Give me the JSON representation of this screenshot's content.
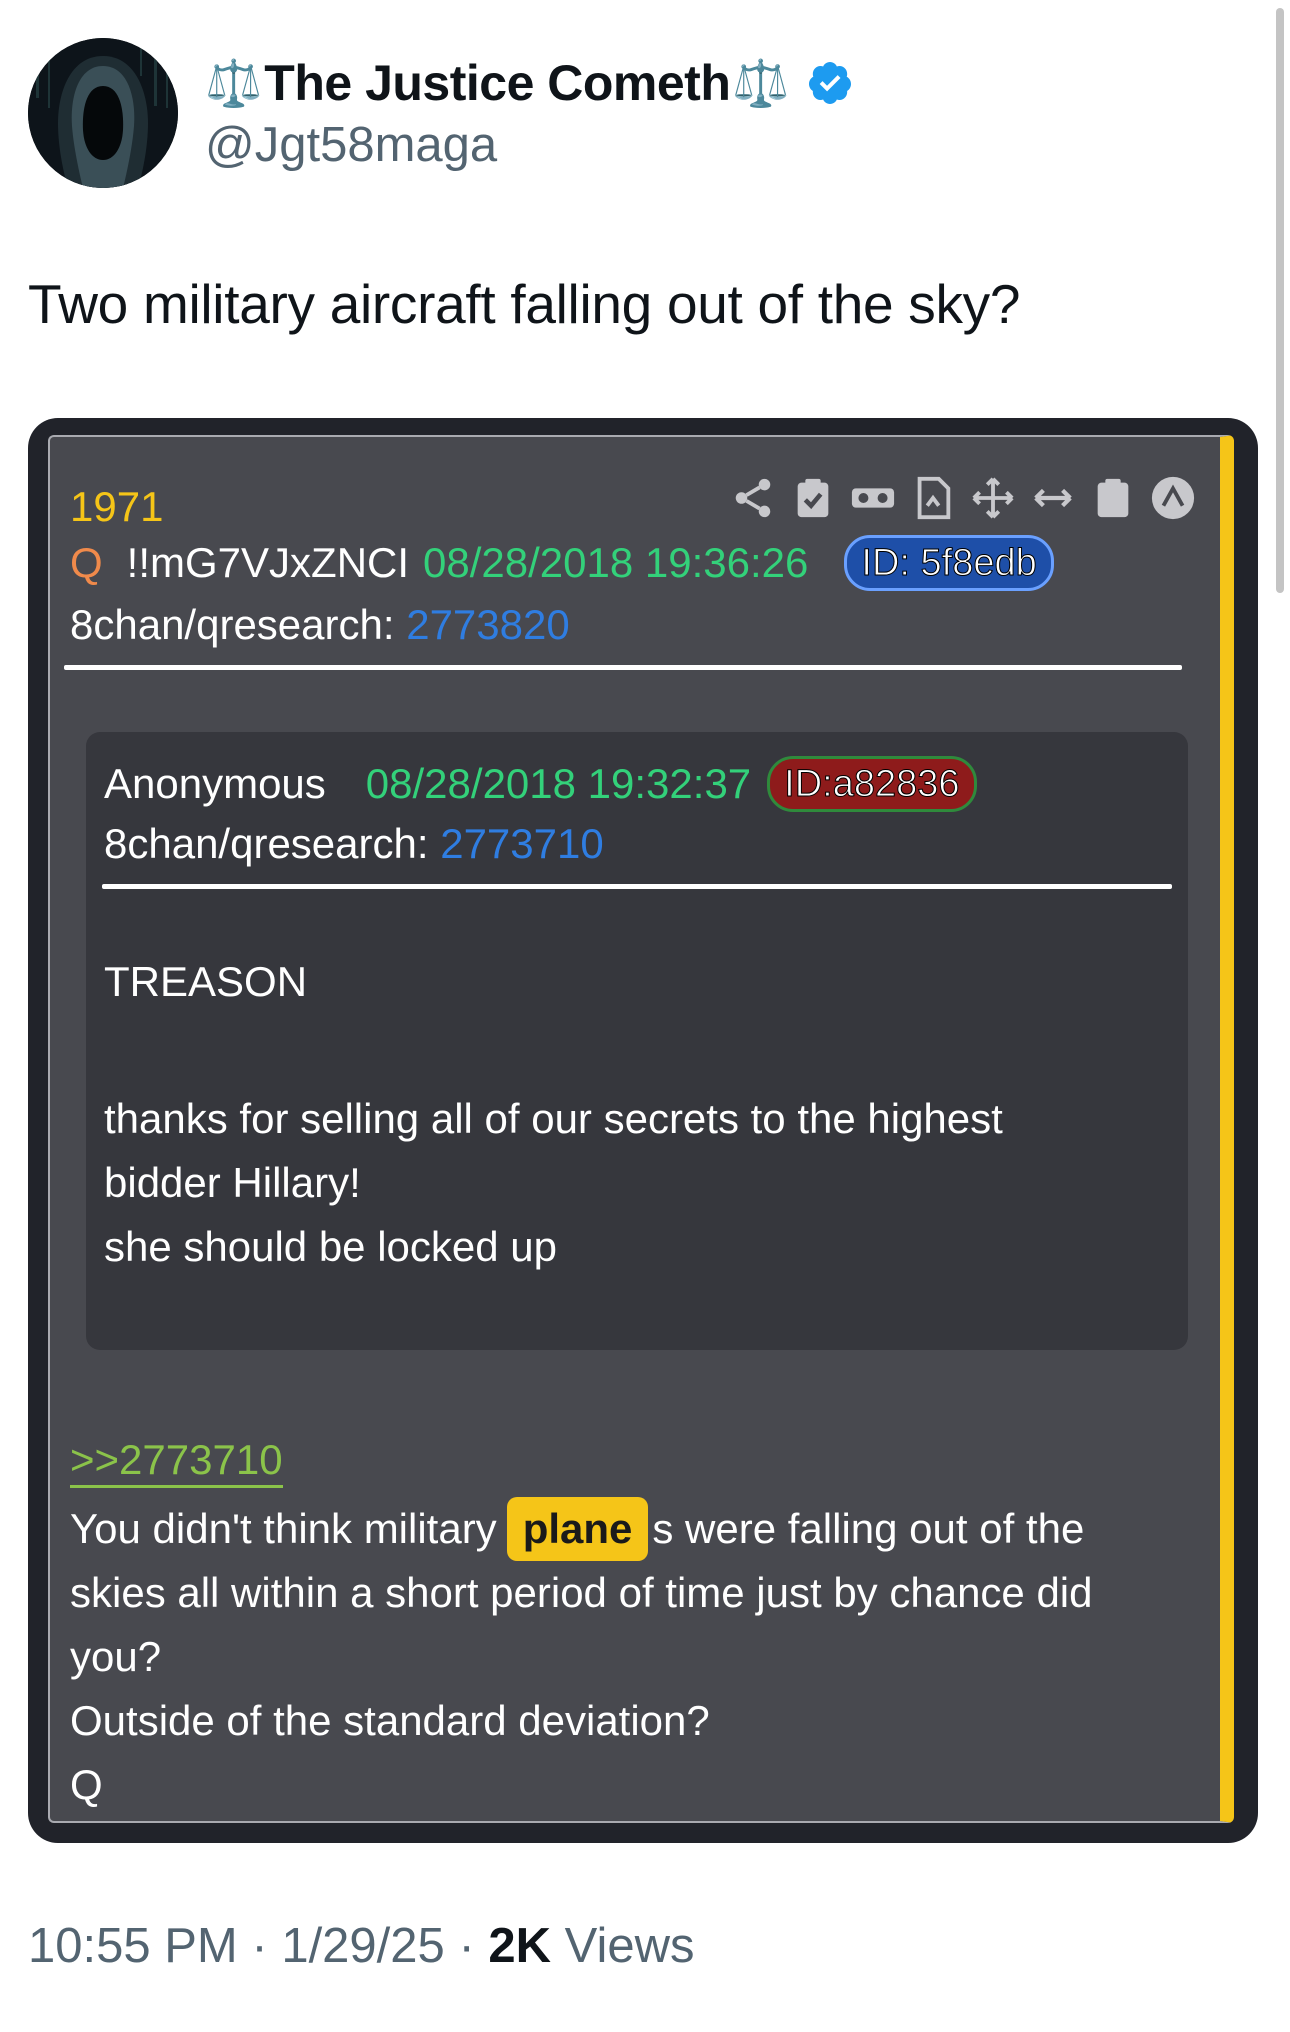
{
  "author": {
    "prefix_emoji": "⚖️",
    "display_name": "The Justice Cometh",
    "suffix_emoji": "⚖️",
    "handle": "@Jgt58maga",
    "verified": true,
    "verified_color": "#1d9bf0"
  },
  "tweet": {
    "text": "Two military aircraft falling out of the sky?"
  },
  "qpost": {
    "number": "1971",
    "author_letter": "Q",
    "tripcode": "!!mG7VJxZNCI",
    "timestamp": "08/28/2018 19:36:26",
    "id_badge": "ID: 5f8edb",
    "board_label": "8chan/qresearch:",
    "board_post": "2773820",
    "toolbar_icons": [
      "share-icon",
      "clipboard-check-icon",
      "glasses-icon",
      "document-icon",
      "move-icon",
      "resize-horizontal-icon",
      "clipboard-icon",
      "scroll-top-icon"
    ],
    "quoted": {
      "author": "Anonymous",
      "timestamp": "08/28/2018 19:32:37",
      "id_badge": "ID:a82836",
      "board_label": "8chan/qresearch:",
      "board_post": "2773710",
      "heading": "TREASON",
      "body_lines": [
        "thanks for selling all of our secrets to the highest",
        "bidder Hillary!",
        "she should be locked up"
      ]
    },
    "reply_link": ">>2773710",
    "reply": {
      "line1_before": "You didn't think military",
      "highlight": "plane",
      "line1_after": "s were falling out of the",
      "line2": "skies all within a short period of time just by chance did",
      "line3": "you?",
      "line4": "Outside of the standard deviation?",
      "line5": "Q"
    },
    "colors": {
      "yellow": "#f5c518",
      "green_timestamp": "#33d17a",
      "blue_link": "#2f7de1",
      "reply_link_green": "#8bc34a",
      "q_orange": "#f08a4b"
    }
  },
  "footer": {
    "time": "10:55 PM",
    "separator": "·",
    "date": "1/29/25",
    "views_count": "2K",
    "views_label": "Views"
  }
}
